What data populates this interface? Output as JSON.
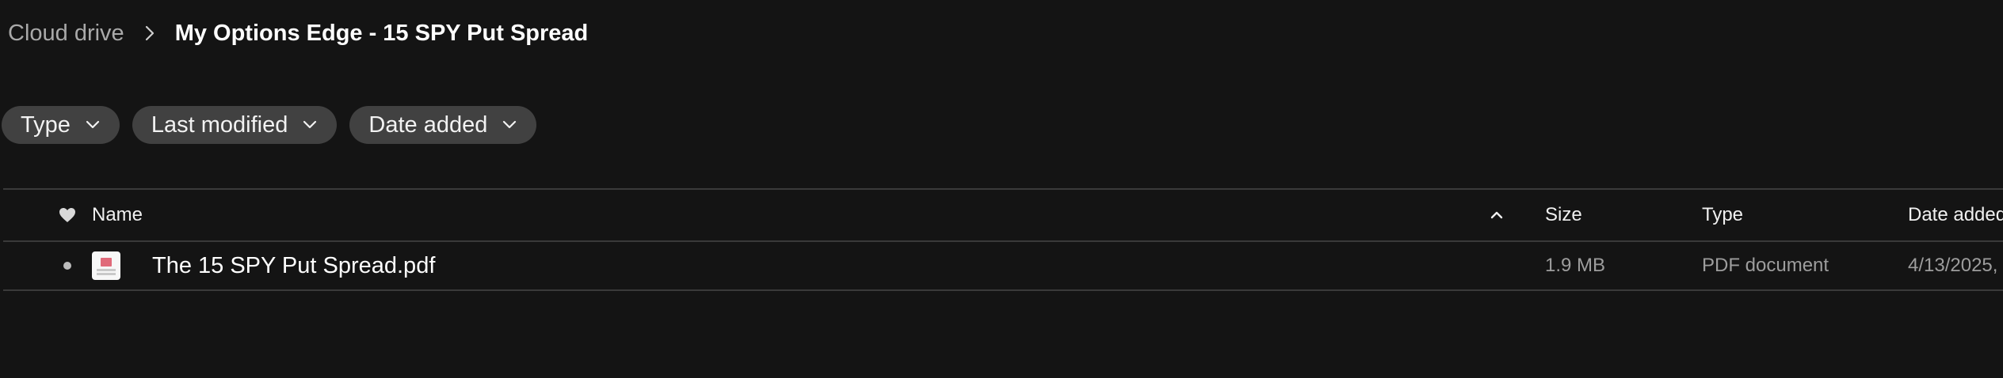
{
  "breadcrumb": {
    "root": "Cloud drive",
    "current": "My Options Edge - 15 SPY Put Spread"
  },
  "filters": [
    {
      "label": "Type"
    },
    {
      "label": "Last modified"
    },
    {
      "label": "Date added"
    }
  ],
  "table": {
    "columns": {
      "name": "Name",
      "size": "Size",
      "type": "Type",
      "date_added": "Date added"
    },
    "sort": {
      "column": "name",
      "direction": "ascending"
    },
    "rows": [
      {
        "name": "The 15 SPY Put Spread.pdf",
        "size": "1.9 MB",
        "type": "PDF document",
        "date_added": "4/13/2025,"
      }
    ]
  },
  "icons": {
    "breadcrumb_separator": "chevron-right-icon",
    "filter_chevron": "chevron-down-icon",
    "favorite": "heart-icon",
    "sort": "chevron-up-icon",
    "file": "pdf-file-icon"
  },
  "colors": {
    "background": "#141414",
    "chip": "#414141",
    "divider": "#3a3a3a",
    "pdf_accent": "#e06a7a"
  }
}
